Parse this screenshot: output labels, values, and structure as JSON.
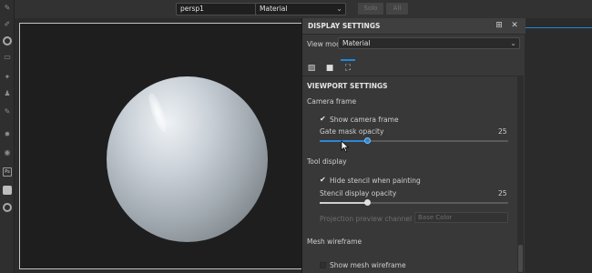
{
  "topbar": {
    "camera_select": "persp1",
    "mode_select": "Material",
    "ghost_btn_1": "Solo",
    "ghost_btn_2": "All"
  },
  "toolbar": {
    "tools": [
      "brush-icon",
      "eraser-icon",
      "fill-icon",
      "picker-icon",
      "clone-icon",
      "smudge-icon",
      "transform-icon",
      "settings-icon",
      "mask-icon",
      "ps-icon",
      "file-icon",
      "target-icon"
    ]
  },
  "panel": {
    "title": "DISPLAY SETTINGS",
    "view_mode_label": "View mode",
    "view_mode_value": "Material",
    "section_title": "VIEWPORT SETTINGS",
    "camera_frame": {
      "heading": "Camera frame",
      "show_label": "Show camera frame",
      "show_checked": true,
      "opacity_label": "Gate mask opacity",
      "opacity_value": "25",
      "opacity_percent": 25
    },
    "tool_display": {
      "heading": "Tool display",
      "hide_label": "Hide stencil when painting",
      "hide_checked": true,
      "stencil_label": "Stencil display opacity",
      "stencil_value": "25",
      "stencil_percent": 25,
      "projection_label": "Projection preview channel",
      "projection_value": "Base Color"
    },
    "mesh_wireframe": {
      "heading": "Mesh wireframe",
      "show_label": "Show mesh wireframe",
      "show_checked": false
    }
  },
  "colors": {
    "accent": "#2d86d4",
    "panel_bg": "#383838",
    "viewport_bg": "#1e1e1e"
  }
}
